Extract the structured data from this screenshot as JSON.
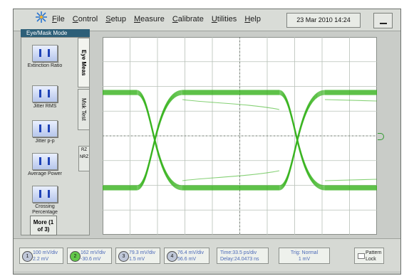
{
  "menubar": {
    "items": [
      "File",
      "Control",
      "Setup",
      "Measure",
      "Calibrate",
      "Utilities",
      "Help"
    ],
    "datetime": "23 Mar 2010  14:24"
  },
  "mode_label": "Eye/Mask Mode",
  "measurements": [
    {
      "label": "Extinction Ratio"
    },
    {
      "label": "Jitter RMS"
    },
    {
      "label": "Jitter p-p"
    },
    {
      "label": "Average Power"
    },
    {
      "label": "Crossing Percentage"
    }
  ],
  "more_button": "More (1 of 3)",
  "tabs": {
    "eye_meas": "Eye Meas",
    "mask_test": "Msk Test"
  },
  "rz_nrz": {
    "rz": "RZ",
    "nrz": "NRZ"
  },
  "channels": [
    {
      "num": "1",
      "line1": "100 mV/div",
      "line2": "2.2 mV"
    },
    {
      "num": "2",
      "line1": "162 mV/div",
      "line2": "-30.6 mV"
    },
    {
      "num": "3",
      "line1": "79.3 mV/div",
      "line2": "1.5 mV"
    },
    {
      "num": "4",
      "line1": "76.4 mV/div",
      "line2": "56.6 mV"
    }
  ],
  "time": {
    "line1": "Time:33.5 ps/div",
    "line2": "Delay:24.0473 ns"
  },
  "trigger": {
    "line1": "Trig: Normal",
    "line2": "1 mV"
  },
  "pattern": {
    "line1": "Pattern",
    "line2": "Lock"
  },
  "colors": {
    "trace": "#35b21b",
    "grid": "#b7c0b7",
    "panel": "#d8dbd6",
    "mode_bar": "#2d5f78"
  }
}
